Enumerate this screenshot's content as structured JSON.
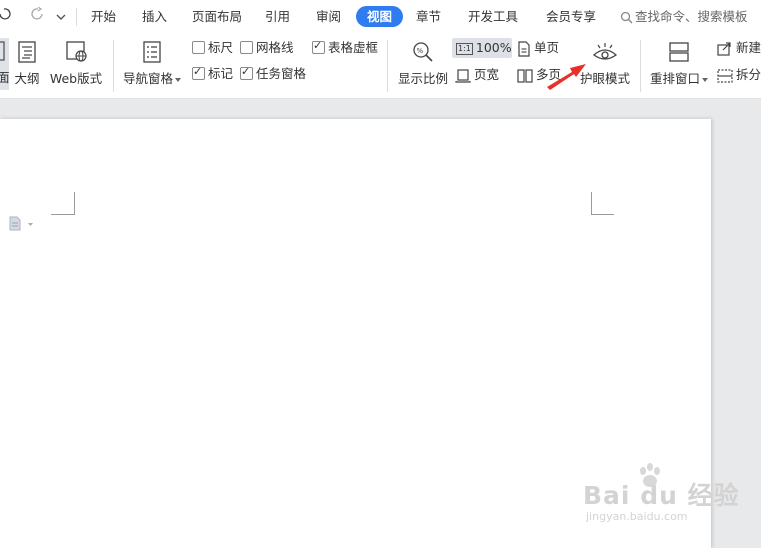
{
  "menubar": {
    "tabs": [
      {
        "label": "开始",
        "active": false
      },
      {
        "label": "插入",
        "active": false
      },
      {
        "label": "页面布局",
        "active": false
      },
      {
        "label": "引用",
        "active": false
      },
      {
        "label": "审阅",
        "active": false
      },
      {
        "label": "视图",
        "active": true
      },
      {
        "label": "章节",
        "active": false
      },
      {
        "label": "开发工具",
        "active": false
      },
      {
        "label": "会员专享",
        "active": false
      }
    ],
    "search_label": "查找命令、搜索模板"
  },
  "ribbon": {
    "partial_left_label": "面",
    "outline_label": "大纲",
    "web_layout_label": "Web版式",
    "nav_pane_label": "导航窗格",
    "ruler": {
      "label": "标尺",
      "checked": false
    },
    "gridlines": {
      "label": "网格线",
      "checked": false
    },
    "table_borders": {
      "label": "表格虚框",
      "checked": true
    },
    "markup": {
      "label": "标记",
      "checked": true
    },
    "task_pane": {
      "label": "任务窗格",
      "checked": true
    },
    "zoom_label": "显示比例",
    "zoom_ratio_icon": "1:1",
    "zoom_100_label": "100%",
    "page_width_label": "页宽",
    "single_page_label": "单页",
    "multi_page_label": "多页",
    "eye_mode_label": "护眼模式",
    "rearrange_label": "重排窗口",
    "new_window_label": "新建",
    "split_label": "拆分"
  },
  "watermark": {
    "main": "Bai du 经验",
    "sub": "jingyan.baidu.com"
  },
  "colors": {
    "accent": "#2f7cf0",
    "annotation_arrow": "#e8302a"
  }
}
